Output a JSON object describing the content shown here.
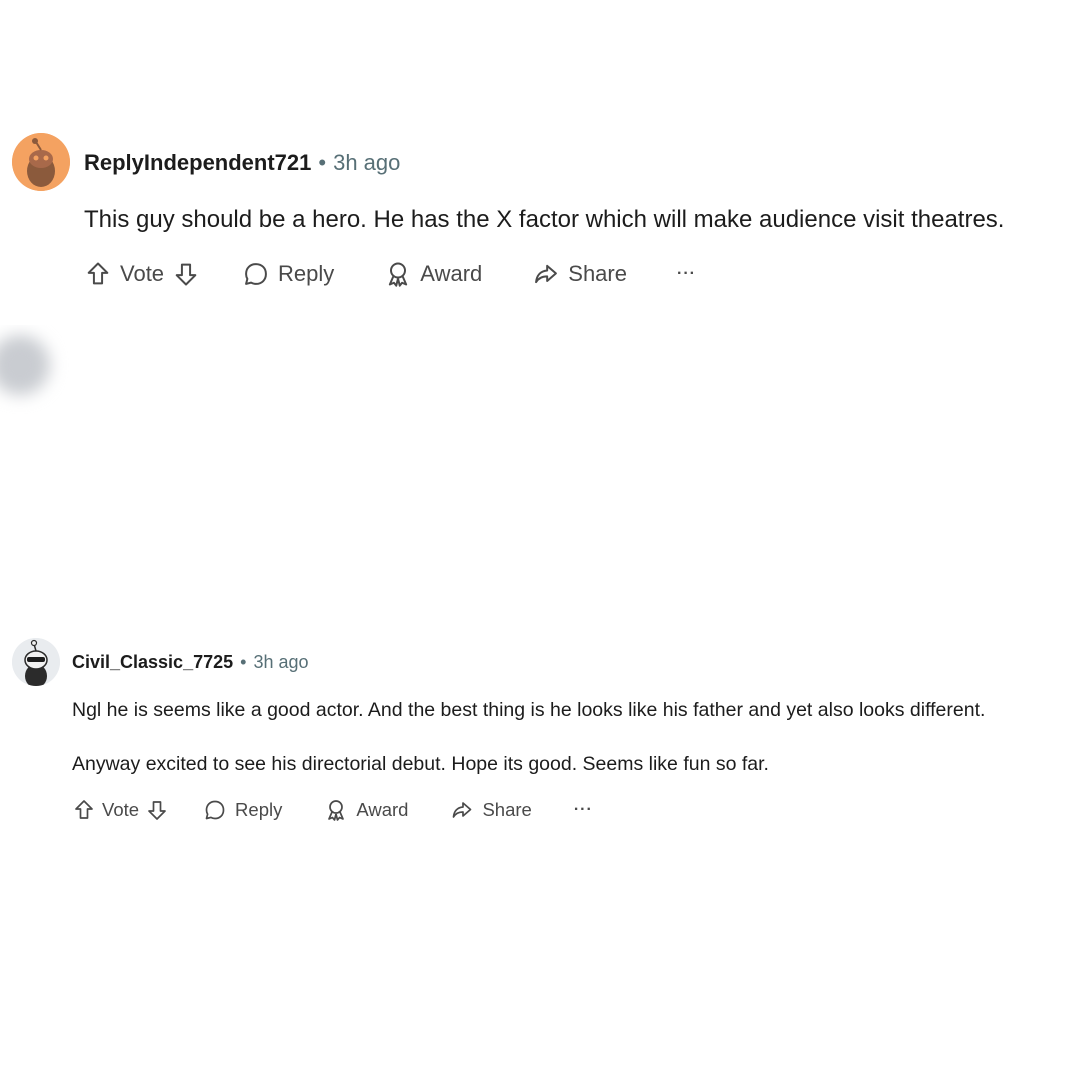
{
  "comments": [
    {
      "author": "ReplyIndependent721",
      "separator": "•",
      "time": "3h ago",
      "body": [
        "This guy should be a hero. He has the X factor which will make audience visit theatres."
      ],
      "actions": {
        "vote": "Vote",
        "reply": "Reply",
        "award": "Award",
        "share": "Share",
        "more": "···"
      },
      "avatar_color": "#f4a261"
    },
    {
      "author": "Civil_Classic_7725",
      "separator": "•",
      "time": "3h ago",
      "body": [
        "Ngl he is seems like a good actor. And the best thing is he looks like his father and yet also looks different.",
        "Anyway excited to see his directorial debut. Hope its good. Seems like fun so far."
      ],
      "actions": {
        "vote": "Vote",
        "reply": "Reply",
        "award": "Award",
        "share": "Share",
        "more": "···"
      },
      "avatar_color": "#e9ecef"
    }
  ],
  "colors": {
    "text": "#1c1c1c",
    "meta": "#576f76",
    "action": "#4a4a4a"
  },
  "icons": [
    "upvote-icon",
    "downvote-icon",
    "reply-icon",
    "award-icon",
    "share-icon",
    "more-icon"
  ]
}
